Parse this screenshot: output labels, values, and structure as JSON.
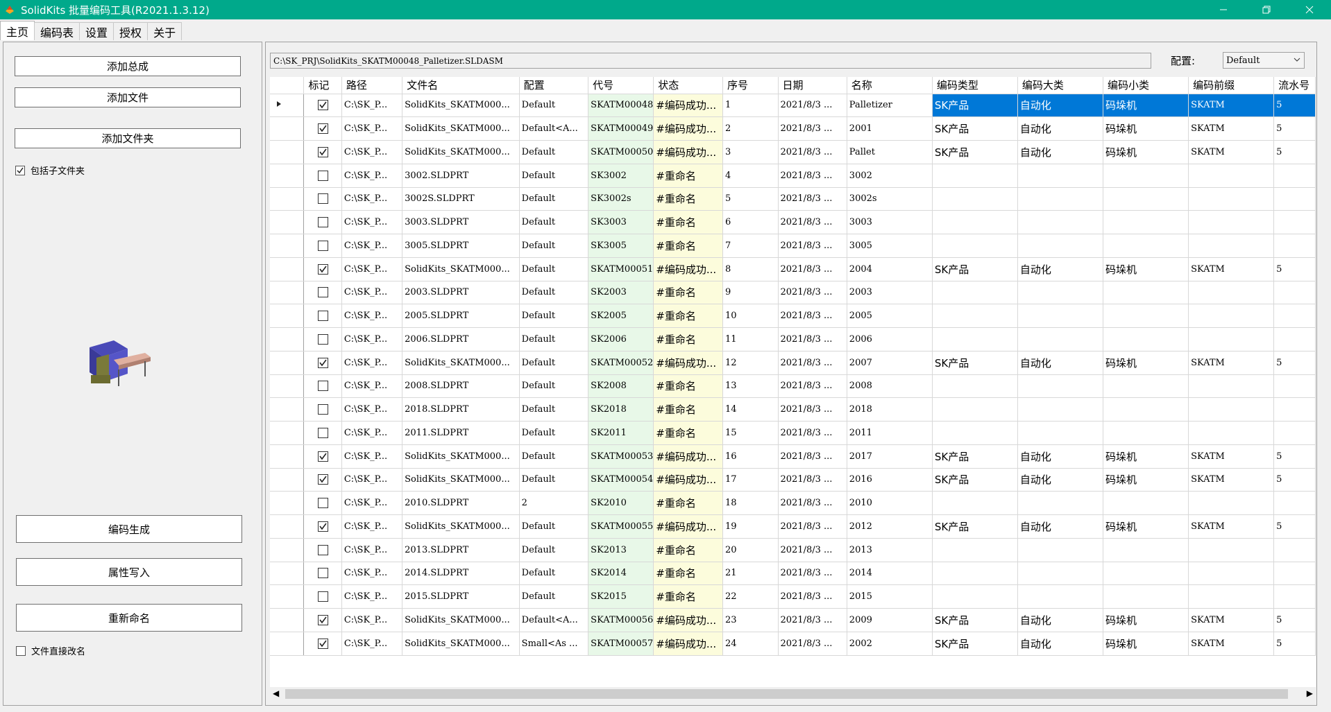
{
  "window": {
    "title": "SolidKits 批量编码工具(R2021.1.3.12)"
  },
  "tabs": [
    {
      "label": "主页"
    },
    {
      "label": "编码表"
    },
    {
      "label": "设置"
    },
    {
      "label": "授权"
    },
    {
      "label": "关于"
    }
  ],
  "left": {
    "add_assembly": "添加总成",
    "add_file": "添加文件",
    "add_folder": "添加文件夹",
    "include_subfolders": "包括子文件夹",
    "generate_code": "编码生成",
    "write_props": "属性写入",
    "rename": "重新命名",
    "rename_direct": "文件直接改名"
  },
  "path": "C:\\SK_PRJ\\SolidKits_SKATM00048_Palletizer.SLDASM",
  "config": {
    "label": "配置:",
    "value": "Default"
  },
  "columns": [
    "标记",
    "路径",
    "文件名",
    "配置",
    "代号",
    "状态",
    "序号",
    "日期",
    "名称",
    "编码类型",
    "编码大类",
    "编码小类",
    "编码前缀",
    "流水号"
  ],
  "rows": [
    {
      "checked": true,
      "path": "C:\\SK_P...",
      "file": "SolidKits_SKATM000...",
      "config": "Default",
      "code": "SKATM00048",
      "status": "#编码成功...",
      "seq": "1",
      "date": "2021/8/3 ...",
      "name": "Palletizer",
      "type": "SK产品",
      "cat": "自动化",
      "sub": "码垛机",
      "prefix": "SKATM",
      "serial": "5"
    },
    {
      "checked": true,
      "path": "C:\\SK_P...",
      "file": "SolidKits_SKATM000...",
      "config": "Default<A...",
      "code": "SKATM00049",
      "status": "#编码成功...",
      "seq": "2",
      "date": "2021/8/3 ...",
      "name": "2001",
      "type": "SK产品",
      "cat": "自动化",
      "sub": "码垛机",
      "prefix": "SKATM",
      "serial": "5"
    },
    {
      "checked": true,
      "path": "C:\\SK_P...",
      "file": "SolidKits_SKATM000...",
      "config": "Default",
      "code": "SKATM00050",
      "status": "#编码成功...",
      "seq": "3",
      "date": "2021/8/3 ...",
      "name": "Pallet",
      "type": "SK产品",
      "cat": "自动化",
      "sub": "码垛机",
      "prefix": "SKATM",
      "serial": "5"
    },
    {
      "checked": false,
      "path": "C:\\SK_P...",
      "file": "3002.SLDPRT",
      "config": "Default",
      "code": "SK3002",
      "status": "#重命名",
      "seq": "4",
      "date": "2021/8/3 ...",
      "name": "3002",
      "type": "",
      "cat": "",
      "sub": "",
      "prefix": "",
      "serial": ""
    },
    {
      "checked": false,
      "path": "C:\\SK_P...",
      "file": "3002S.SLDPRT",
      "config": "Default",
      "code": "SK3002s",
      "status": "#重命名",
      "seq": "5",
      "date": "2021/8/3 ...",
      "name": "3002s",
      "type": "",
      "cat": "",
      "sub": "",
      "prefix": "",
      "serial": ""
    },
    {
      "checked": false,
      "path": "C:\\SK_P...",
      "file": "3003.SLDPRT",
      "config": "Default",
      "code": "SK3003",
      "status": "#重命名",
      "seq": "6",
      "date": "2021/8/3 ...",
      "name": "3003",
      "type": "",
      "cat": "",
      "sub": "",
      "prefix": "",
      "serial": ""
    },
    {
      "checked": false,
      "path": "C:\\SK_P...",
      "file": "3005.SLDPRT",
      "config": "Default",
      "code": "SK3005",
      "status": "#重命名",
      "seq": "7",
      "date": "2021/8/3 ...",
      "name": "3005",
      "type": "",
      "cat": "",
      "sub": "",
      "prefix": "",
      "serial": ""
    },
    {
      "checked": true,
      "path": "C:\\SK_P...",
      "file": "SolidKits_SKATM000...",
      "config": "Default",
      "code": "SKATM00051",
      "status": "#编码成功...",
      "seq": "8",
      "date": "2021/8/3 ...",
      "name": "2004",
      "type": "SK产品",
      "cat": "自动化",
      "sub": "码垛机",
      "prefix": "SKATM",
      "serial": "5"
    },
    {
      "checked": false,
      "path": "C:\\SK_P...",
      "file": "2003.SLDPRT",
      "config": "Default",
      "code": "SK2003",
      "status": "#重命名",
      "seq": "9",
      "date": "2021/8/3 ...",
      "name": "2003",
      "type": "",
      "cat": "",
      "sub": "",
      "prefix": "",
      "serial": ""
    },
    {
      "checked": false,
      "path": "C:\\SK_P...",
      "file": "2005.SLDPRT",
      "config": "Default",
      "code": "SK2005",
      "status": "#重命名",
      "seq": "10",
      "date": "2021/8/3 ...",
      "name": "2005",
      "type": "",
      "cat": "",
      "sub": "",
      "prefix": "",
      "serial": ""
    },
    {
      "checked": false,
      "path": "C:\\SK_P...",
      "file": "2006.SLDPRT",
      "config": "Default",
      "code": "SK2006",
      "status": "#重命名",
      "seq": "11",
      "date": "2021/8/3 ...",
      "name": "2006",
      "type": "",
      "cat": "",
      "sub": "",
      "prefix": "",
      "serial": ""
    },
    {
      "checked": true,
      "path": "C:\\SK_P...",
      "file": "SolidKits_SKATM000...",
      "config": "Default",
      "code": "SKATM00052",
      "status": "#编码成功...",
      "seq": "12",
      "date": "2021/8/3 ...",
      "name": "2007",
      "type": "SK产品",
      "cat": "自动化",
      "sub": "码垛机",
      "prefix": "SKATM",
      "serial": "5"
    },
    {
      "checked": false,
      "path": "C:\\SK_P...",
      "file": "2008.SLDPRT",
      "config": "Default",
      "code": "SK2008",
      "status": "#重命名",
      "seq": "13",
      "date": "2021/8/3 ...",
      "name": "2008",
      "type": "",
      "cat": "",
      "sub": "",
      "prefix": "",
      "serial": ""
    },
    {
      "checked": false,
      "path": "C:\\SK_P...",
      "file": "2018.SLDPRT",
      "config": "Default",
      "code": "SK2018",
      "status": "#重命名",
      "seq": "14",
      "date": "2021/8/3 ...",
      "name": "2018",
      "type": "",
      "cat": "",
      "sub": "",
      "prefix": "",
      "serial": ""
    },
    {
      "checked": false,
      "path": "C:\\SK_P...",
      "file": "2011.SLDPRT",
      "config": "Default",
      "code": "SK2011",
      "status": "#重命名",
      "seq": "15",
      "date": "2021/8/3 ...",
      "name": "2011",
      "type": "",
      "cat": "",
      "sub": "",
      "prefix": "",
      "serial": ""
    },
    {
      "checked": true,
      "path": "C:\\SK_P...",
      "file": "SolidKits_SKATM000...",
      "config": "Default",
      "code": "SKATM00053",
      "status": "#编码成功...",
      "seq": "16",
      "date": "2021/8/3 ...",
      "name": "2017",
      "type": "SK产品",
      "cat": "自动化",
      "sub": "码垛机",
      "prefix": "SKATM",
      "serial": "5"
    },
    {
      "checked": true,
      "path": "C:\\SK_P...",
      "file": "SolidKits_SKATM000...",
      "config": "Default",
      "code": "SKATM00054",
      "status": "#编码成功...",
      "seq": "17",
      "date": "2021/8/3 ...",
      "name": "2016",
      "type": "SK产品",
      "cat": "自动化",
      "sub": "码垛机",
      "prefix": "SKATM",
      "serial": "5"
    },
    {
      "checked": false,
      "path": "C:\\SK_P...",
      "file": "2010.SLDPRT",
      "config": "2",
      "code": "SK2010",
      "status": "#重命名",
      "seq": "18",
      "date": "2021/8/3 ...",
      "name": "2010",
      "type": "",
      "cat": "",
      "sub": "",
      "prefix": "",
      "serial": ""
    },
    {
      "checked": true,
      "path": "C:\\SK_P...",
      "file": "SolidKits_SKATM000...",
      "config": "Default",
      "code": "SKATM00055",
      "status": "#编码成功...",
      "seq": "19",
      "date": "2021/8/3 ...",
      "name": "2012",
      "type": "SK产品",
      "cat": "自动化",
      "sub": "码垛机",
      "prefix": "SKATM",
      "serial": "5"
    },
    {
      "checked": false,
      "path": "C:\\SK_P...",
      "file": "2013.SLDPRT",
      "config": "Default",
      "code": "SK2013",
      "status": "#重命名",
      "seq": "20",
      "date": "2021/8/3 ...",
      "name": "2013",
      "type": "",
      "cat": "",
      "sub": "",
      "prefix": "",
      "serial": ""
    },
    {
      "checked": false,
      "path": "C:\\SK_P...",
      "file": "2014.SLDPRT",
      "config": "Default",
      "code": "SK2014",
      "status": "#重命名",
      "seq": "21",
      "date": "2021/8/3 ...",
      "name": "2014",
      "type": "",
      "cat": "",
      "sub": "",
      "prefix": "",
      "serial": ""
    },
    {
      "checked": false,
      "path": "C:\\SK_P...",
      "file": "2015.SLDPRT",
      "config": "Default",
      "code": "SK2015",
      "status": "#重命名",
      "seq": "22",
      "date": "2021/8/3 ...",
      "name": "2015",
      "type": "",
      "cat": "",
      "sub": "",
      "prefix": "",
      "serial": ""
    },
    {
      "checked": true,
      "path": "C:\\SK_P...",
      "file": "SolidKits_SKATM000...",
      "config": "Default<A...",
      "code": "SKATM00056",
      "status": "#编码成功...",
      "seq": "23",
      "date": "2021/8/3 ...",
      "name": "2009",
      "type": "SK产品",
      "cat": "自动化",
      "sub": "码垛机",
      "prefix": "SKATM",
      "serial": "5"
    },
    {
      "checked": true,
      "path": "C:\\SK_P...",
      "file": "SolidKits_SKATM000...",
      "config": "Small<As ...",
      "code": "SKATM00057",
      "status": "#编码成功...",
      "seq": "24",
      "date": "2021/8/3 ...",
      "name": "2002",
      "type": "SK产品",
      "cat": "自动化",
      "sub": "码垛机",
      "prefix": "SKATM",
      "serial": "5"
    }
  ],
  "colors": {
    "titlebar": "#00a98b",
    "selection": "#0078d7",
    "code_bg": "#e8f8e8",
    "status_bg": "#fcfcdc"
  }
}
